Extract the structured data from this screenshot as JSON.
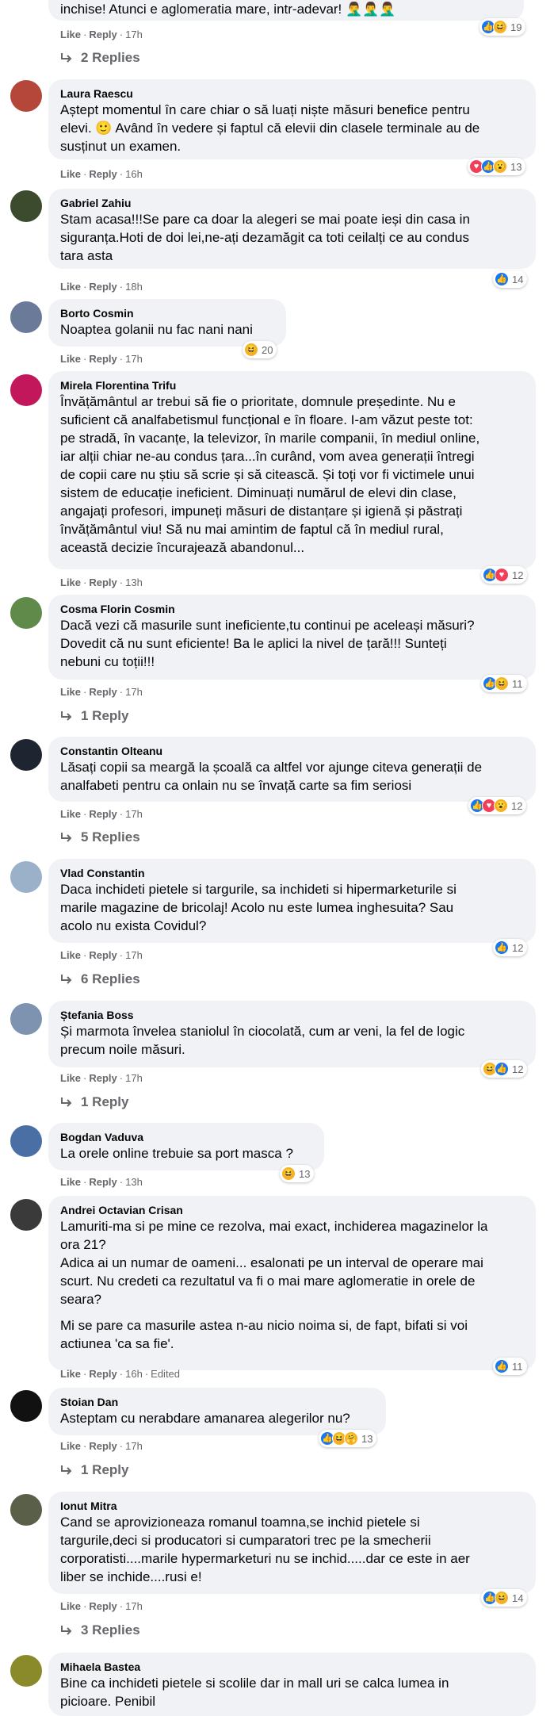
{
  "comments": [
    {
      "text": "inchise! Atunci e aglomeratia mare, intr-adevar! 🤦‍♂️🤦‍♂️🤦‍♂️",
      "like": "Like",
      "reply": "Reply",
      "time": "17h",
      "reactions": [
        "like",
        "haha"
      ],
      "count": "19",
      "replies": "2 Replies"
    },
    {
      "author": "Laura Raescu",
      "lines": [
        "Aștept momentul în care chiar o să luați niște măsuri benefice pentru",
        "elevi. 🙂 Având în vedere și faptul că elevii din clasele terminale au de",
        "susținut un examen."
      ],
      "like": "Like",
      "reply": "Reply",
      "time": "16h",
      "reactions": [
        "love",
        "like",
        "wow"
      ],
      "count": "13",
      "avatar_color": "#b5473a"
    },
    {
      "author": "Gabriel Zahiu",
      "lines": [
        "Stam acasa!!!Se pare ca doar la alegeri se mai poate ieși din casa in",
        "siguranța.Hoti de doi lei,ne-ați dezamăgit ca toti ceilalți ce au condus",
        "tara asta"
      ],
      "like": "Like",
      "reply": "Reply",
      "time": "18h",
      "reactions": [
        "like"
      ],
      "count": "14",
      "avatar_color": "#3c4a2e"
    },
    {
      "author": "Borto Cosmin",
      "lines": [
        "Noaptea golanii nu fac nani nani"
      ],
      "like": "Like",
      "reply": "Reply",
      "time": "17h",
      "reactions": [
        "haha"
      ],
      "count": "20",
      "avatar_color": "#6b7a99"
    },
    {
      "author": "Mirela Florentina Trifu",
      "lines": [
        "Învățământul ar trebui să fie o prioritate, domnule președinte. Nu e",
        "suficient că analfabetismul funcțional e în floare. I-am văzut peste tot:",
        "pe stradă, în vacanțe, la televizor, în marile companii, în mediul online,",
        "iar alții chiar ne-au condus țara...în curând, vom avea generații întregi",
        "de copii care nu știu să scrie și să citească. Și toți vor fi victimele unui",
        "sistem de educație ineficient. Diminuați numărul de elevi din clase,",
        "angajați profesori, impuneți măsuri de distanțare și igienă și păstrați",
        "învățământul viu! Să nu mai amintim de faptul că în mediul rural,",
        "această decizie încurajează abandonul..."
      ],
      "like": "Like",
      "reply": "Reply",
      "time": "13h",
      "reactions": [
        "like",
        "love"
      ],
      "count": "12",
      "avatar_color": "#c2185b"
    },
    {
      "author": "Cosma Florin Cosmin",
      "lines": [
        "Dacă vezi că masurile sunt ineficiente,tu continui pe aceleași măsuri?",
        "Dovedit că nu sunt eficiente! Ba le aplici la nivel de țară!!! Sunteți",
        "nebuni cu toții!!!"
      ],
      "like": "Like",
      "reply": "Reply",
      "time": "17h",
      "reactions": [
        "like",
        "haha"
      ],
      "count": "11",
      "replies": "1 Reply",
      "avatar_color": "#5f8a4a"
    },
    {
      "author": "Constantin Olteanu",
      "lines": [
        "Lăsați copii sa meargă la școală ca altfel vor ajunge citeva generații de",
        "analfabeti pentru ca onlain nu se învață carte sa fim seriosi"
      ],
      "like": "Like",
      "reply": "Reply",
      "time": "17h",
      "reactions": [
        "like",
        "love",
        "wow"
      ],
      "count": "12",
      "replies": "5 Replies",
      "avatar_color": "#1e2530"
    },
    {
      "author": "Vlad Constantin",
      "lines": [
        "Daca inchideti pietele si targurile, sa inchideti si hipermarketurile si",
        "marile magazine de bricolaj! Acolo nu este lumea inghesuita? Sau",
        "acolo nu exista Covidul?"
      ],
      "like": "Like",
      "reply": "Reply",
      "time": "17h",
      "reactions": [
        "like"
      ],
      "count": "12",
      "replies": "6 Replies",
      "avatar_color": "#9bb0c9"
    },
    {
      "author": "Ștefania Boss",
      "lines": [
        "Și marmota învelea staniolul în ciocolată, cum ar veni, la fel de logic",
        "precum noile măsuri."
      ],
      "like": "Like",
      "reply": "Reply",
      "time": "17h",
      "reactions": [
        "haha",
        "like"
      ],
      "count": "12",
      "replies": "1 Reply",
      "avatar_color": "#7d93b0"
    },
    {
      "author": "Bogdan Vaduva",
      "lines": [
        "La orele online trebuie sa port masca ?"
      ],
      "like": "Like",
      "reply": "Reply",
      "time": "13h",
      "reactions": [
        "haha"
      ],
      "count": "13",
      "avatar_color": "#4a6fa5"
    },
    {
      "author": "Andrei Octavian Crisan",
      "lines": [
        "Lamuriti-ma si pe mine ce rezolva, mai exact, inchiderea magazinelor la",
        "ora 21?",
        "Adica ai un numar de oameni... esalonati pe un interval de operare mai",
        "scurt. Nu credeti ca rezultatul va fi o mai mare aglomeratie in orele de",
        "seara?",
        "",
        "Mi se pare ca masurile astea n-au nicio noima si, de fapt, bifati si voi",
        "actiunea 'ca sa fie'."
      ],
      "like": "Like",
      "reply": "Reply",
      "time": "16h",
      "edited": "Edited",
      "reactions": [
        "like"
      ],
      "count": "11",
      "avatar_color": "#3a3a3a"
    },
    {
      "author": "Stoian Dan",
      "lines": [
        "Asteptam cu nerabdare amanarea alegerilor nu?"
      ],
      "like": "Like",
      "reply": "Reply",
      "time": "17h",
      "reactions": [
        "like",
        "haha",
        "care"
      ],
      "count": "13",
      "replies": "1 Reply",
      "avatar_color": "#111111"
    },
    {
      "author": "Ionut Mitra",
      "lines": [
        "Cand se aprovizioneaza romanul toamna,se inchid pietele si",
        "targurile,deci si producatori si cumparatori trec pe la smecherii",
        "corporatisti....marile hypermarketuri nu se inchid.....dar ce este in aer",
        "liber se inchide....rusi e!"
      ],
      "like": "Like",
      "reply": "Reply",
      "time": "17h",
      "reactions": [
        "like",
        "haha"
      ],
      "count": "14",
      "replies": "3 Replies",
      "avatar_color": "#5a5f4a"
    },
    {
      "author": "Mihaela Bastea",
      "lines": [
        "Bine ca inchideti pietele si scolile dar in mall uri se calca lumea in",
        "picioare. Penibil"
      ],
      "avatar_color": "#8a8a2a"
    }
  ]
}
